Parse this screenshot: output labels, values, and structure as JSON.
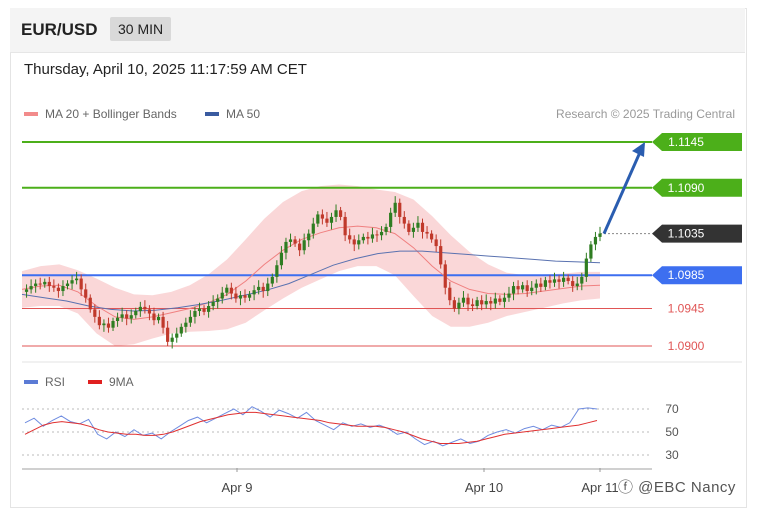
{
  "header": {
    "symbol": "EUR/USD",
    "timeframe": "30 MIN"
  },
  "timestamp": "Thursday, April 10, 2025 11:17:59 AM CET",
  "legend": {
    "items": [
      {
        "label": "MA 20 + Bollinger Bands",
        "color": "#f28b8b"
      },
      {
        "label": "MA 50",
        "color": "#3a5ba0"
      }
    ],
    "credit": "Research © 2025 Trading Central"
  },
  "rsi_legend": {
    "items": [
      {
        "label": "RSI",
        "color": "#5b7bd5"
      },
      {
        "label": "9MA",
        "color": "#e02020"
      }
    ]
  },
  "watermark": "ⓕ @EBC  Nancy",
  "colors": {
    "up": "#2f7d22",
    "down": "#c0392b",
    "resistance": "#4caf1a",
    "pivot": "#3d6ff0",
    "support": "#e05555",
    "arrow": "#2a5db0"
  },
  "chart_data": [
    {
      "type": "line",
      "title": "EUR/USD",
      "xlabel": "",
      "ylabel": "",
      "x_ticks": [
        "Apr 9",
        "Apr 10",
        "Apr 11"
      ],
      "ylim": [
        1.0885,
        1.116
      ],
      "levels": [
        {
          "label": "1.1145",
          "value": 1.1145,
          "kind": "resistance"
        },
        {
          "label": "1.1090",
          "value": 1.109,
          "kind": "resistance"
        },
        {
          "label": "1.1035",
          "value": 1.1035,
          "kind": "last"
        },
        {
          "label": "1.0985",
          "value": 1.0985,
          "kind": "pivot"
        },
        {
          "label": "1.0945",
          "value": 1.0945,
          "kind": "support"
        },
        {
          "label": "1.0900",
          "value": 1.09,
          "kind": "support"
        }
      ],
      "target_arrow": {
        "from": 1.1035,
        "to": 1.1145
      },
      "series": [
        {
          "name": "Price",
          "values": [
            1.0965,
            1.0968,
            1.0972,
            1.0975,
            1.0974,
            1.0977,
            1.0972,
            1.097,
            1.0966,
            1.0972,
            1.0975,
            1.0979,
            1.0981,
            1.0968,
            1.0958,
            1.0944,
            1.0935,
            1.0925,
            1.0927,
            1.0922,
            1.093,
            1.0934,
            1.0938,
            1.0933,
            1.0937,
            1.0942,
            1.0947,
            1.0944,
            1.0939,
            1.0931,
            1.0935,
            1.0922,
            1.0905,
            1.091,
            1.0915,
            1.0923,
            1.0928,
            1.0935,
            1.0942,
            1.0945,
            1.0941,
            1.0948,
            1.0953,
            1.0957,
            1.0964,
            1.097,
            1.0963,
            1.0957,
            1.0961,
            1.0958,
            1.0962,
            1.0967,
            1.0971,
            1.0966,
            1.0975,
            1.0983,
            1.0997,
            1.1012,
            1.1025,
            1.1028,
            1.1023,
            1.1015,
            1.1027,
            1.1035,
            1.1047,
            1.1058,
            1.1053,
            1.1048,
            1.1055,
            1.1063,
            1.1055,
            1.1033,
            1.1028,
            1.1022,
            1.1027,
            1.1031,
            1.1029,
            1.1034,
            1.1033,
            1.1037,
            1.1043,
            1.106,
            1.1072,
            1.1055,
            1.1047,
            1.1037,
            1.1042,
            1.1048,
            1.1037,
            1.1035,
            1.1028,
            1.102,
            1.0998,
            1.097,
            1.0955,
            1.0945,
            1.0952,
            1.0958,
            1.095,
            1.0948,
            1.0955,
            1.095,
            1.0954,
            1.0951,
            1.0957,
            1.0953,
            1.0958,
            1.0963,
            1.0972,
            1.0968,
            1.0973,
            1.0966,
            1.097,
            1.0975,
            1.0971,
            1.0979,
            1.0976,
            1.098,
            1.0977,
            1.0982,
            1.0978,
            1.0972,
            1.0975,
            1.0983,
            1.1005,
            1.1022,
            1.1031,
            1.1035
          ]
        },
        {
          "name": "MA 20",
          "values": [
            1.0968,
            1.0972,
            1.0973,
            1.0965,
            1.0948,
            1.0935,
            1.0932,
            1.0935,
            1.094,
            1.0945,
            1.0952,
            1.0962,
            1.0978,
            1.0998,
            1.1015,
            1.1028,
            1.1036,
            1.1042,
            1.1044,
            1.1042,
            1.1035,
            1.1018,
            1.0996,
            1.0978,
            1.0968,
            1.0963,
            1.0962,
            1.0963,
            1.0966,
            1.0969,
            1.0972,
            1.0973
          ]
        },
        {
          "name": "MA 50",
          "values": [
            1.0962,
            1.0958,
            1.0954,
            1.0948,
            1.0944,
            1.0942,
            1.0943,
            1.0946,
            1.095,
            1.0955,
            1.0961,
            1.0967,
            1.0975,
            1.0986,
            1.0997,
            1.1005,
            1.1011,
            1.1014,
            1.1014,
            1.1012,
            1.101,
            1.1008,
            1.1006,
            1.1004,
            1.1002,
            1.1001,
            1.1
          ]
        }
      ]
    },
    {
      "type": "line",
      "title": "",
      "xlabel": "",
      "ylabel": "",
      "x_ticks": [
        "Apr 9",
        "Apr 10",
        "Apr 11"
      ],
      "y_ticks": [
        "70",
        "50",
        "30"
      ],
      "ylim": [
        25,
        80
      ],
      "series": [
        {
          "name": "RSI",
          "values": [
            58,
            62,
            55,
            60,
            64,
            59,
            57,
            61,
            48,
            44,
            50,
            46,
            52,
            47,
            49,
            44,
            50,
            55,
            60,
            63,
            58,
            62,
            66,
            70,
            65,
            72,
            68,
            63,
            69,
            66,
            62,
            67,
            60,
            56,
            52,
            58,
            55,
            57,
            54,
            56,
            53,
            48,
            50,
            44,
            39,
            42,
            38,
            41,
            44,
            40,
            42,
            47,
            50,
            52,
            49,
            53,
            55,
            52,
            56,
            54,
            58,
            70,
            71,
            70
          ]
        },
        {
          "name": "9MA",
          "values": [
            48,
            52,
            56,
            58,
            59,
            58,
            57,
            55,
            52,
            50,
            49,
            48,
            48,
            47,
            47,
            48,
            50,
            53,
            56,
            59,
            61,
            63,
            65,
            66,
            67,
            67,
            66,
            65,
            64,
            63,
            62,
            61,
            60,
            58,
            57,
            56,
            55,
            55,
            55,
            54,
            52,
            50,
            47,
            44,
            42,
            40,
            40,
            40,
            41,
            42,
            44,
            46,
            48,
            49,
            50,
            51,
            52,
            53,
            54,
            55,
            56,
            58,
            60
          ]
        }
      ]
    }
  ]
}
